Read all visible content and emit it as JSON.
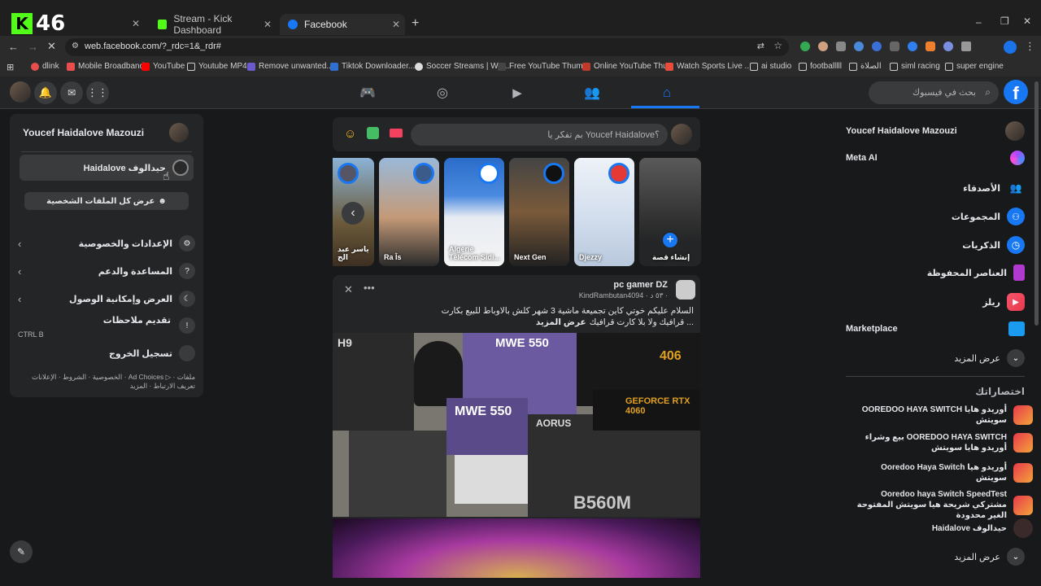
{
  "browser": {
    "profile_badge": "46",
    "tabs": [
      {
        "label": "Stream - Kick Dashboard"
      },
      {
        "label": "Facebook"
      }
    ],
    "url": "web.facebook.com/?_rdc=1&_rdr#",
    "bookmarks": [
      "dlink",
      "Mobile Broadband",
      "YouTube",
      "Youtube MP4",
      "Remove unwanted...",
      "Tiktok Downloader...",
      "Soccer Streams | Wa...",
      "Free YouTube Thum...",
      "Online YouTube Thu...",
      "Watch Sports Live ...",
      "ai studio",
      "footballlll",
      "الصلاة",
      "siml racing",
      "super engine"
    ]
  },
  "fb": {
    "search_placeholder": "بحث في فيسبوك",
    "account_menu": {
      "user_name": "Youcef Haidalove Mazouzi",
      "page_name": "Haidalove حيدالوف",
      "see_all_profiles": "عرض كل الملفات الشخصية",
      "settings": "الإعدادات والخصوصية",
      "help": "المساعدة والدعم",
      "display": "العرض وإمكانية الوصول",
      "feedback": "تقديم ملاحظات",
      "feedback_shortcut": "CTRL B",
      "logout": "تسجيل الخروج",
      "footer": "الخصوصية · الشروط · الإعلانات · Ad Choices ▷ · ملفات تعريف الارتباط · المزيد"
    },
    "composer": {
      "placeholder": "بم تفكر يا Youcef Haidalove؟"
    },
    "stories": [
      {
        "label": "ياسر عبد الج"
      },
      {
        "label": "Ra Îs"
      },
      {
        "label": "Algérie Télécom Sidi..."
      },
      {
        "label": "Next Gen"
      },
      {
        "label": "Djezzy"
      },
      {
        "label": "إنشاء قصة"
      }
    ],
    "post": {
      "author": "pc gamer DZ",
      "meta": "KindRambutan4094 · ٥٣ د ·",
      "text_line1": "السلام عليكم خوتي كاين تجميعة  ماشية 3 شهر كلش بالاوباط للبيع بكارت",
      "text_line2": "قرافيك ولا بلا كارت قرافيك ...",
      "see_more": "عرض المزيد"
    },
    "right_nav": {
      "profile": "Youcef Haidalove Mazouzi",
      "meta_ai": "Meta AI",
      "friends": "الأصدقاء",
      "groups": "المجموعات",
      "memories": "الذكريات",
      "saved": "العناصر المحفوظة",
      "reels": "ريلز",
      "marketplace": "Marketplace",
      "see_more": "عرض المزيد",
      "shortcuts_title": "اختصاراتك",
      "shortcuts": [
        "OOREDOO HAYA SWITCH أوريدو هايا سويتش",
        "بيع وشراء OOREDOO HAYA SWITCH أوريدو هايا سويتش",
        "Ooredoo Haya Switch أوريدو هيا سويتش",
        "Ooredoo haya Switch SpeedTest مشتركي شريحة هيا سويتش المفتوحة الغير محدودة",
        "Haidalove حيدالوف"
      ],
      "see_more2": "عرض المزيد"
    }
  },
  "colors": {
    "accent": "#1877f2",
    "bg": "#18191a",
    "panel": "#242526",
    "kick_green": "#53fc18"
  },
  "icons": [
    "kick-logo-icon",
    "facebook-logo-icon",
    "search-icon",
    "home-icon",
    "bell-icon",
    "messenger-icon",
    "menu-grid-icon"
  ]
}
